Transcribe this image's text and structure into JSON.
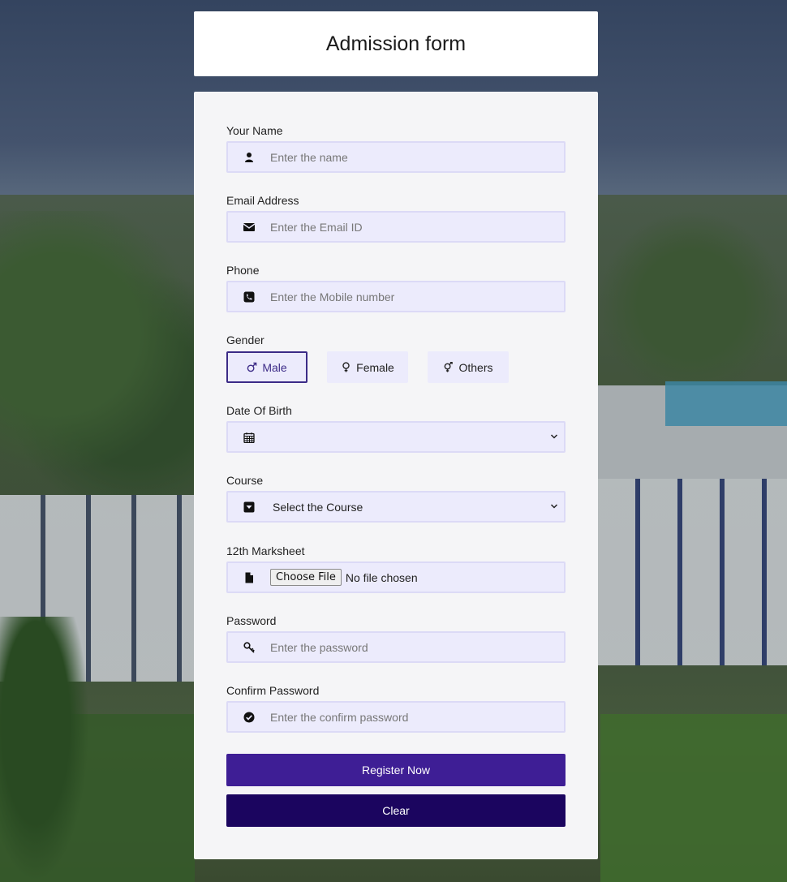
{
  "header": {
    "title": "Admission form"
  },
  "form": {
    "name": {
      "label": "Your Name",
      "placeholder": "Enter the name",
      "icon": "user-icon"
    },
    "email": {
      "label": "Email Address",
      "placeholder": "Enter the Email ID",
      "icon": "envelope-icon"
    },
    "phone": {
      "label": "Phone",
      "placeholder": "Enter the Mobile number",
      "icon": "phone-icon"
    },
    "gender": {
      "label": "Gender",
      "options": [
        {
          "label": "Male",
          "icon": "male-icon",
          "selected": true
        },
        {
          "label": "Female",
          "icon": "female-icon",
          "selected": false
        },
        {
          "label": "Others",
          "icon": "transgender-icon",
          "selected": false
        }
      ]
    },
    "dob": {
      "label": "Date Of Birth",
      "icon": "calendar-icon"
    },
    "course": {
      "label": "Course",
      "value": "Select the Course",
      "icon": "dropdown-box-icon"
    },
    "marksheet": {
      "label": "12th Marksheet",
      "button": "Choose File",
      "status": "No file chosen",
      "icon": "file-icon"
    },
    "password": {
      "label": "Password",
      "placeholder": "Enter the password",
      "icon": "key-icon"
    },
    "confirm": {
      "label": "Confirm Password",
      "placeholder": "Enter the confirm password",
      "icon": "check-circle-icon"
    }
  },
  "actions": {
    "register": "Register Now",
    "clear": "Clear"
  },
  "colors": {
    "primary": "#3e1e95",
    "dark": "#1b055f",
    "input_bg": "#ecebfc"
  }
}
